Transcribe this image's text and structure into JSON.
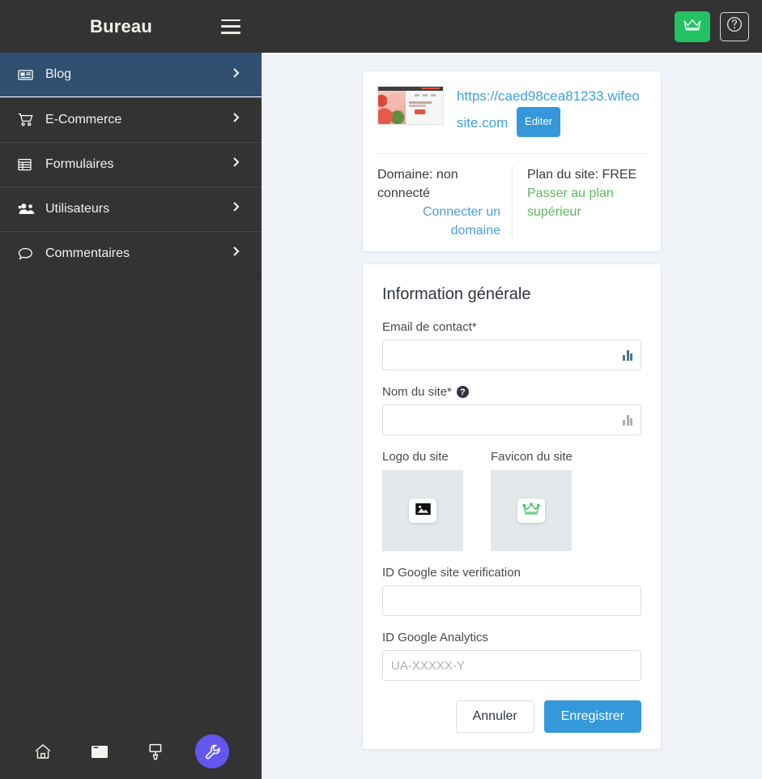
{
  "sidebar": {
    "brand": "Bureau",
    "menu_icon": "hamburger-icon",
    "items": [
      {
        "label": "Blog",
        "icon": "newspaper-icon",
        "active": true
      },
      {
        "label": "E-Commerce",
        "icon": "shopping-cart-icon",
        "active": false
      },
      {
        "label": "Formulaires",
        "icon": "form-table-icon",
        "active": false
      },
      {
        "label": "Utilisateurs",
        "icon": "users-group-icon",
        "active": false
      },
      {
        "label": "Commentaires",
        "icon": "comment-bubble-icon",
        "active": false
      }
    ],
    "bottom_bar": [
      {
        "icon": "home-icon"
      },
      {
        "icon": "browser-window-icon"
      },
      {
        "icon": "paint-roller-icon"
      },
      {
        "icon": "wrench-icon"
      }
    ]
  },
  "topbar": {
    "upgrade_icon": "crown-icon",
    "help_icon": "question-circle-icon",
    "upgrade_color": "#24c263"
  },
  "site_card": {
    "thumbnail_icon": "website-thumbnail",
    "url": "https://caed98cea81233.wifeosite.com",
    "edit_label": "Editer",
    "domain_status": "Domaine: non connecté",
    "domain_link": "Connecter un domaine",
    "plan_status": "Plan du site: FREE",
    "plan_link": "Passer au plan supérieur",
    "link_color": "#4a9fd8",
    "plan_link_color": "#5cb85c",
    "edit_button_color": "#3498db"
  },
  "form": {
    "title": "Information générale",
    "email": {
      "label": "Email de contact*",
      "value": "",
      "placeholder": "",
      "assist_icon": "grammarly-icon"
    },
    "site_name": {
      "label": "Nom du site*",
      "help_icon": "question-circle-icon",
      "value": "",
      "placeholder": "",
      "assist_icon": "grammarly-icon"
    },
    "logo": {
      "label": "Logo du site",
      "icon": "image-placeholder-icon"
    },
    "favicon": {
      "label": "Favicon du site",
      "icon": "crown-icon"
    },
    "google_verification": {
      "label": "ID Google site verification",
      "value": "",
      "placeholder": ""
    },
    "google_analytics": {
      "label": "ID Google Analytics",
      "value": "",
      "placeholder": "UA-XXXXX-Y"
    },
    "cancel_label": "Annuler",
    "save_label": "Enregistrer"
  }
}
